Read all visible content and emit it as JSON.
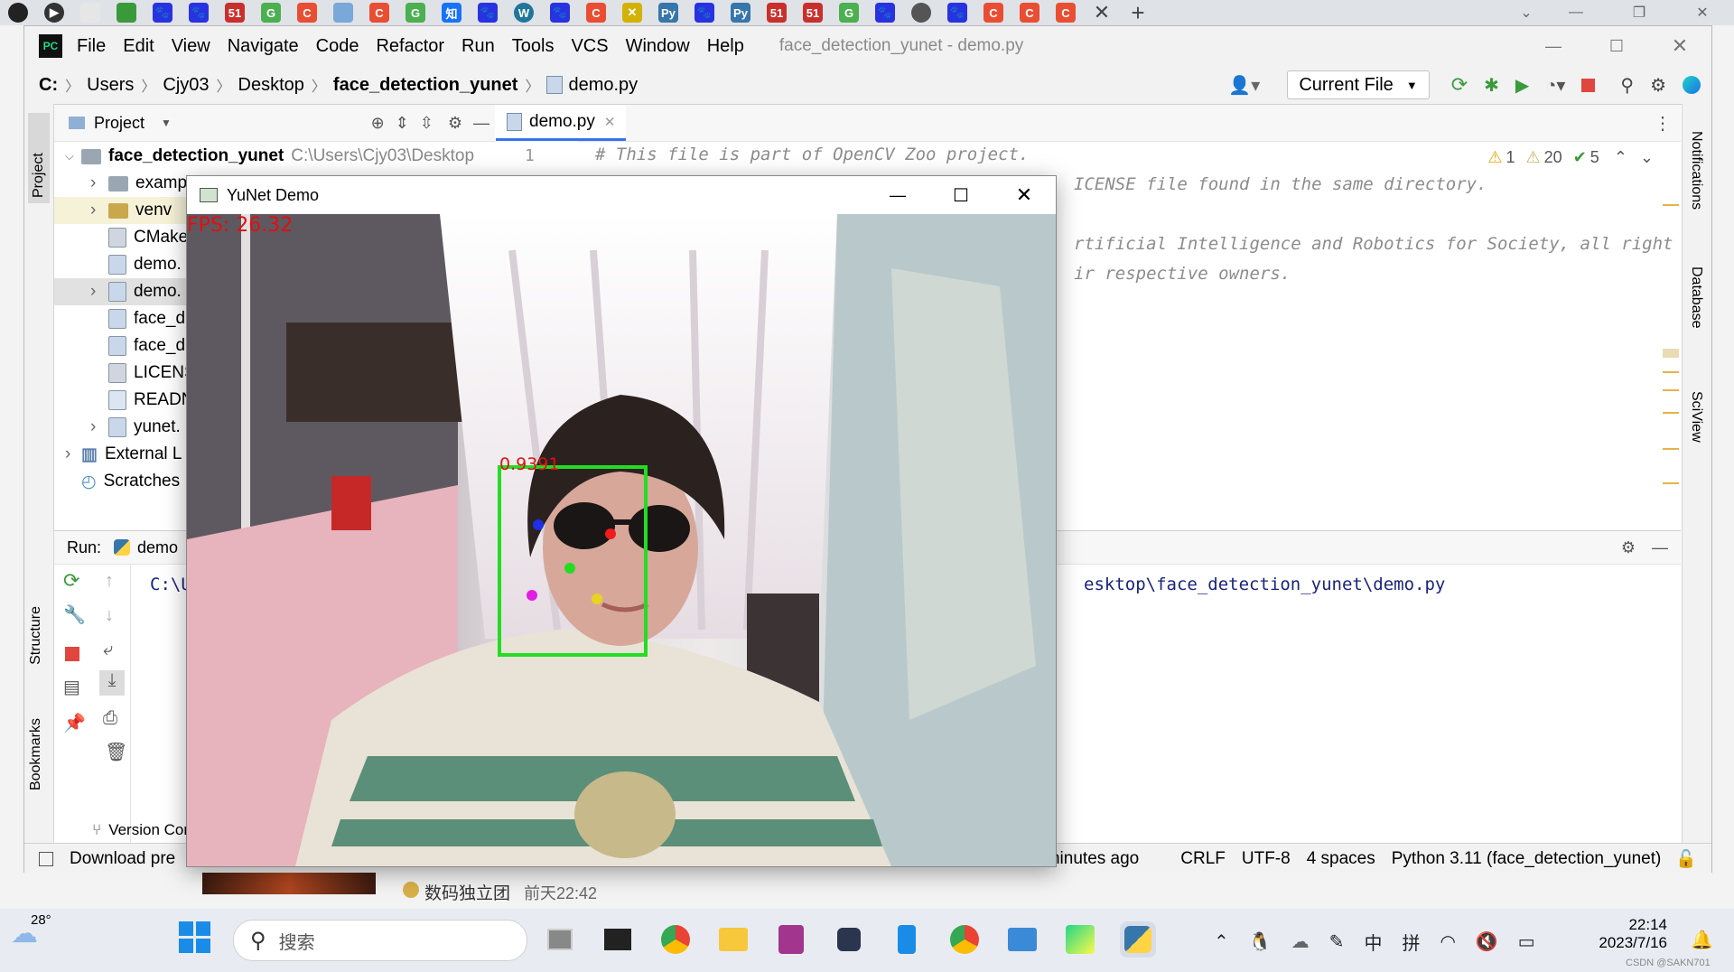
{
  "ide": {
    "menu": [
      "File",
      "Edit",
      "View",
      "Navigate",
      "Code",
      "Refactor",
      "Run",
      "Tools",
      "VCS",
      "Window",
      "Help"
    ],
    "window_title": "face_detection_yunet - demo.py",
    "breadcrumbs": [
      "C:",
      "Users",
      "Cjy03",
      "Desktop",
      "face_detection_yunet",
      "demo.py"
    ],
    "run_config": "Current File",
    "project_panel": {
      "title": "Project",
      "tree": [
        {
          "label": "face_detection_yunet",
          "extra": "C:\\Users\\Cjy03\\Desktop"
        },
        {
          "label": "examp"
        },
        {
          "label": "venv"
        },
        {
          "label": "CMake"
        },
        {
          "label": "demo."
        },
        {
          "label": "demo."
        },
        {
          "label": "face_d"
        },
        {
          "label": "face_d"
        },
        {
          "label": "LICENS"
        },
        {
          "label": "READN"
        },
        {
          "label": "yunet."
        },
        {
          "label": "External L"
        },
        {
          "label": "Scratches"
        }
      ]
    },
    "editor": {
      "tab": "demo.py",
      "line_number": "1",
      "lines": [
        "# This file is part of OpenCV Zoo project.",
        "ICENSE file found in the same directory.",
        "",
        "rtificial Intelligence and Robotics for Society, all right",
        "ir respective owners."
      ],
      "inspections": {
        "warnings": "1",
        "weak_warnings": "20",
        "ok": "5"
      }
    },
    "run_panel": {
      "label": "Run:",
      "tab": "demo",
      "output_start": "C:\\U",
      "output_end": "esktop\\face_detection_yunet\\demo.py"
    },
    "left_strip": [
      "Project",
      "Structure",
      "Bookmarks"
    ],
    "right_strip": [
      "Notifications",
      "Database",
      "SciView"
    ],
    "version_control": "Version Contr",
    "status": {
      "left": "Download pre",
      "time_ago": "minutes ago",
      "line_sep": "CRLF",
      "encoding": "UTF-8",
      "indent": "4 spaces",
      "interpreter": "Python 3.11 (face_detection_yunet)"
    }
  },
  "yunet": {
    "title": "YuNet Demo",
    "fps": "FPS: 26.32",
    "confidence": "0.9391"
  },
  "background_app": {
    "name": "数码独立团",
    "time": "前天22:42"
  },
  "taskbar": {
    "weather": "28°",
    "search_placeholder": "搜索",
    "ime1": "中",
    "ime2": "拼",
    "time": "22:14",
    "date": "2023/7/16",
    "watermark": "CSDN @SAKN701"
  },
  "colors": {
    "box": "#22dd22",
    "fps_text": "#e01010",
    "accent": "#3574f0"
  }
}
